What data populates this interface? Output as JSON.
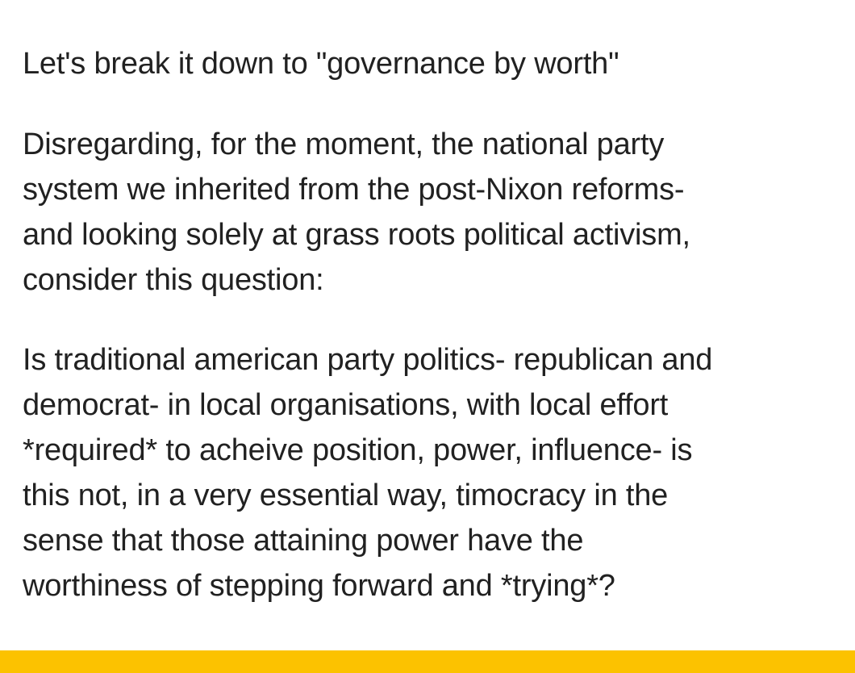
{
  "post": {
    "cut_text": "",
    "paragraphs": [
      "Let's break it down to \"governance by worth\"",
      "Disregarding, for the moment, the national party\nsystem we inherited from the post-Nixon reforms-\nand looking solely at grass roots political activism,\nconsider this question:",
      "Is traditional american party politics- republican and\ndemocrat- in local organisations, with local effort\n*required* to acheive position, power, influence- is\nthis not, in a very essential way, timocracy in the\nsense that those attaining power have the\nworthiness of stepping forward and *trying*?"
    ]
  },
  "colors": {
    "text": "#212121",
    "background": "#ffffff",
    "bottom_bar": "#fcc200"
  }
}
